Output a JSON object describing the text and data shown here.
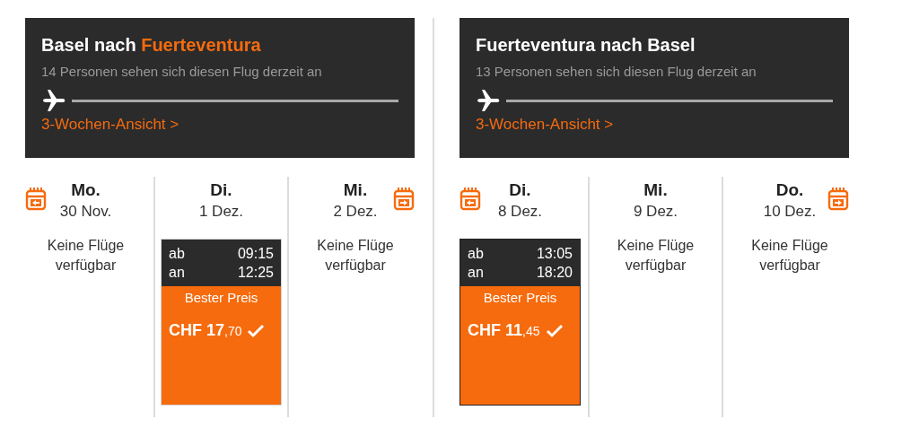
{
  "trips": [
    {
      "title_parts": [
        {
          "text": "Basel nach ",
          "highlight": false
        },
        {
          "text": "Fuerteventura",
          "highlight": true
        }
      ],
      "viewers": "14 Personen sehen sich diesen Flug derzeit an",
      "link": "3-Wochen-Ansicht >",
      "days": [
        {
          "kind": "none",
          "weekday": "Mo.",
          "date": "30 Nov.",
          "message": "Keine Flüge verfügbar"
        },
        {
          "kind": "flight",
          "weekday": "Di.",
          "date": "1 Dez.",
          "depart_label": "ab",
          "depart": "09:15",
          "arrive_label": "an",
          "arrive": "12:25",
          "badge": "Bester Preis",
          "price": "CHF 17",
          "cents": ",70",
          "selected": false
        },
        {
          "kind": "none",
          "weekday": "Mi.",
          "date": "2 Dez.",
          "message": "Keine Flüge verfügbar"
        }
      ]
    },
    {
      "title_parts": [
        {
          "text": "Fuerteventura nach Basel",
          "highlight": false
        }
      ],
      "viewers": "13 Personen sehen sich diesen Flug derzeit an",
      "link": "3-Wochen-Ansicht >",
      "days": [
        {
          "kind": "flight",
          "weekday": "Di.",
          "date": "8 Dez.",
          "depart_label": "ab",
          "depart": "13:05",
          "arrive_label": "an",
          "arrive": "18:20",
          "badge": "Bester Preis",
          "price": "CHF 11",
          "cents": ",45",
          "selected": true
        },
        {
          "kind": "none",
          "weekday": "Mi.",
          "date": "9 Dez.",
          "message": "Keine Flüge verfügbar"
        },
        {
          "kind": "none",
          "weekday": "Do.",
          "date": "10 Dez.",
          "message": "Keine Flüge verfügbar"
        }
      ]
    }
  ]
}
